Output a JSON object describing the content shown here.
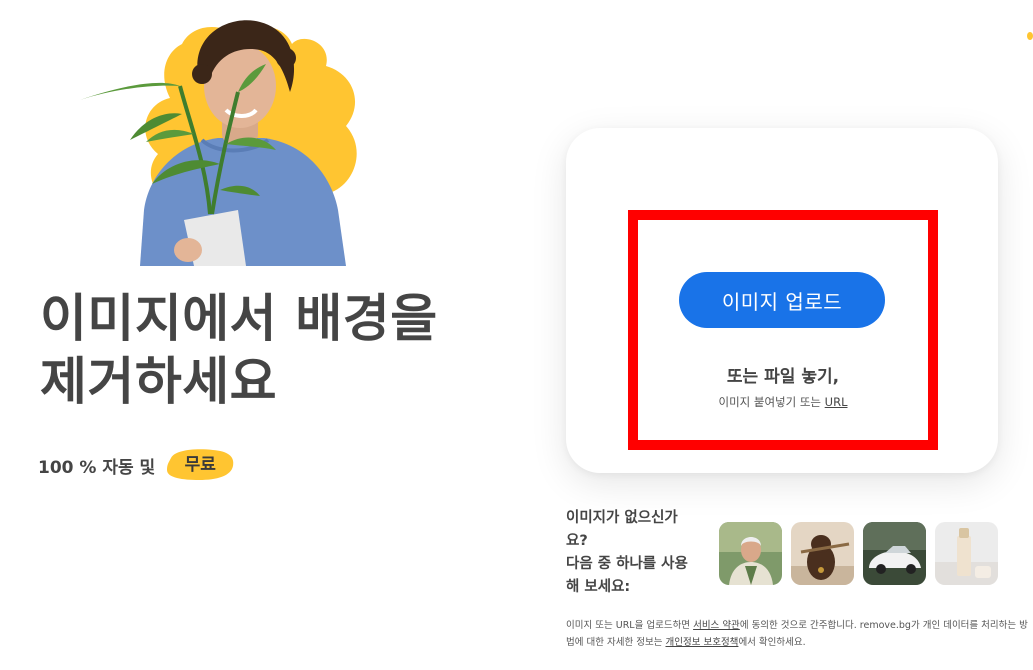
{
  "hero": {
    "headline_line1": "이미지에서 배경을",
    "headline_line2": "제거하세요",
    "tagline": "100 % 자동 및",
    "free_badge": "무료",
    "illustration": "person-holding-plant-image"
  },
  "upload": {
    "button_label": "이미지 업로드",
    "drop_label": "또는 파일 놓기,",
    "paste_hint": "이미지 붙여넣기 또는",
    "url_link": "URL"
  },
  "samples": {
    "prompt_line1": "이미지가 없으신가",
    "prompt_line2": "요?",
    "prompt_line3": "다음 중 하나를 사용",
    "prompt_line4": "해 보세요:",
    "items": [
      {
        "icon": "sample-person-image"
      },
      {
        "icon": "sample-dog-image"
      },
      {
        "icon": "sample-car-image"
      },
      {
        "icon": "sample-cosmetics-image"
      }
    ]
  },
  "legal": {
    "part1": "이미지 또는 URL을 업로드하면 ",
    "terms_link": "서비스 약관",
    "part2": "에 동의한 것으로 간주합니다. remove.bg가 개인 데이터를 처리하는 방법에 대한 자세한 정보는 ",
    "privacy_link": "개인정보 보호정책",
    "part3": "에서 확인하세요."
  },
  "colors": {
    "accent_blue": "#1973e8",
    "brand_yellow": "#ffc531",
    "highlight_red": "#ff0000",
    "text_dark": "#454545"
  }
}
